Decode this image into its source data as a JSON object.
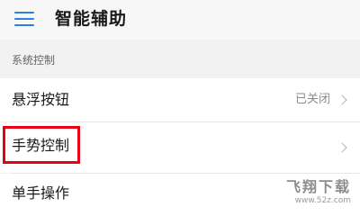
{
  "header": {
    "menu_icon": "hamburger-menu-icon",
    "title": "智能辅助",
    "accent_color": "#2f7fe0"
  },
  "section": {
    "label": "系统控制"
  },
  "rows": [
    {
      "label": "悬浮按钮",
      "value": "已关闭",
      "chevron": true
    },
    {
      "label": "手势控制",
      "value": "",
      "chevron": true,
      "highlighted": true
    },
    {
      "label": "单手操作"
    }
  ],
  "highlight_color": "#e60012",
  "watermark": {
    "brand": "飞翔下载",
    "url": "www.52z.com"
  }
}
